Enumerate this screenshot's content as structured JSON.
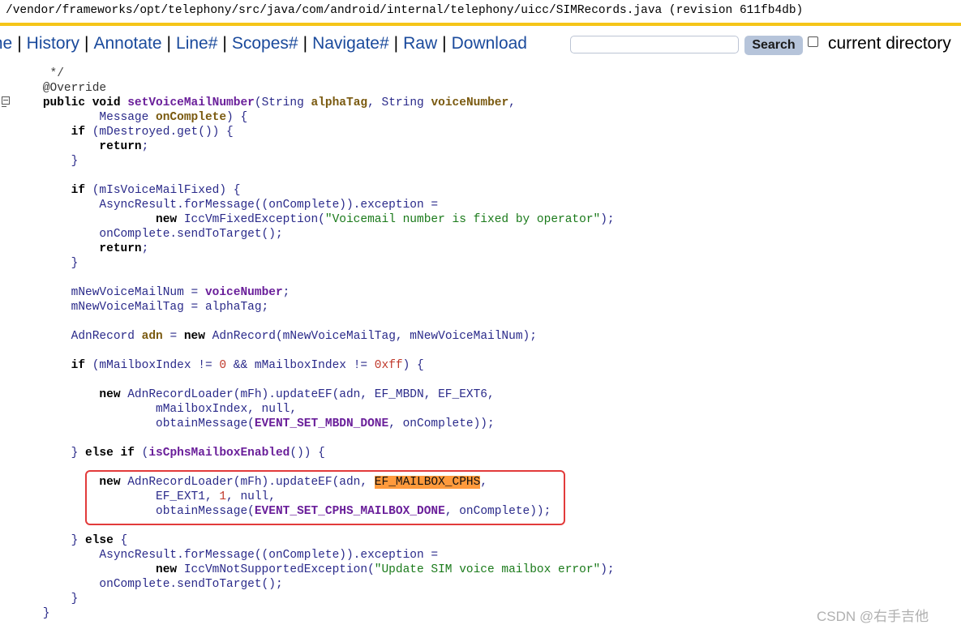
{
  "path_bar": "/vendor/frameworks/opt/telephony/src/java/com/android/internal/telephony/uicc/SIMRecords.java (revision 611fb4db)",
  "nav": {
    "links": [
      "me",
      "History",
      "Annotate",
      "Line#",
      "Scopes#",
      "Navigate#",
      "Raw",
      "Download"
    ],
    "separator": "|"
  },
  "search": {
    "input_value": "",
    "button_label": "Search"
  },
  "current_directory": {
    "label": "current directory",
    "checked": false
  },
  "code_lines": [
    [
      {
        "t": "     */",
        "c": "cm"
      }
    ],
    [
      {
        "t": "    @Override",
        "c": "ann"
      }
    ],
    [
      {
        "t": "    ",
        "c": ""
      },
      {
        "t": "public void ",
        "c": "kw"
      },
      {
        "t": "setVoiceMailNumber",
        "c": "fn"
      },
      {
        "t": "(String ",
        "c": ""
      },
      {
        "t": "alphaTag",
        "c": "lv"
      },
      {
        "t": ", String ",
        "c": ""
      },
      {
        "t": "voiceNumber",
        "c": "lv"
      },
      {
        "t": ",",
        "c": ""
      }
    ],
    [
      {
        "t": "            Message ",
        "c": ""
      },
      {
        "t": "onComplete",
        "c": "lv"
      },
      {
        "t": ") {",
        "c": ""
      }
    ],
    [
      {
        "t": "        ",
        "c": ""
      },
      {
        "t": "if",
        "c": "kw"
      },
      {
        "t": " (mDestroyed.get()) {",
        "c": ""
      }
    ],
    [
      {
        "t": "            ",
        "c": ""
      },
      {
        "t": "return",
        "c": "kw"
      },
      {
        "t": ";",
        "c": ""
      }
    ],
    [
      {
        "t": "        }",
        "c": ""
      }
    ],
    [
      {
        "t": "",
        "c": ""
      }
    ],
    [
      {
        "t": "        ",
        "c": ""
      },
      {
        "t": "if",
        "c": "kw"
      },
      {
        "t": " (mIsVoiceMailFixed) {",
        "c": ""
      }
    ],
    [
      {
        "t": "            AsyncResult.forMessage((onComplete)).exception =",
        "c": ""
      }
    ],
    [
      {
        "t": "                    ",
        "c": ""
      },
      {
        "t": "new",
        "c": "kw"
      },
      {
        "t": " IccVmFixedException(",
        "c": ""
      },
      {
        "t": "\"Voicemail number is fixed by operator\"",
        "c": "str"
      },
      {
        "t": ");",
        "c": ""
      }
    ],
    [
      {
        "t": "            onComplete.sendToTarget();",
        "c": ""
      }
    ],
    [
      {
        "t": "            ",
        "c": ""
      },
      {
        "t": "return",
        "c": "kw"
      },
      {
        "t": ";",
        "c": ""
      }
    ],
    [
      {
        "t": "        }",
        "c": ""
      }
    ],
    [
      {
        "t": "",
        "c": ""
      }
    ],
    [
      {
        "t": "        mNewVoiceMailNum = ",
        "c": ""
      },
      {
        "t": "voiceNumber",
        "c": "fn"
      },
      {
        "t": ";",
        "c": ""
      }
    ],
    [
      {
        "t": "        mNewVoiceMailTag = alphaTag;",
        "c": ""
      }
    ],
    [
      {
        "t": "",
        "c": ""
      }
    ],
    [
      {
        "t": "        AdnRecord ",
        "c": ""
      },
      {
        "t": "adn",
        "c": "lv"
      },
      {
        "t": " = ",
        "c": ""
      },
      {
        "t": "new",
        "c": "kw"
      },
      {
        "t": " AdnRecord(mNewVoiceMailTag, mNewVoiceMailNum);",
        "c": ""
      }
    ],
    [
      {
        "t": "",
        "c": ""
      }
    ],
    [
      {
        "t": "        ",
        "c": ""
      },
      {
        "t": "if",
        "c": "kw"
      },
      {
        "t": " (mMailboxIndex != ",
        "c": ""
      },
      {
        "t": "0",
        "c": "num"
      },
      {
        "t": " && mMailboxIndex != ",
        "c": ""
      },
      {
        "t": "0xff",
        "c": "num"
      },
      {
        "t": ") {",
        "c": ""
      }
    ],
    [
      {
        "t": "",
        "c": ""
      }
    ],
    [
      {
        "t": "            ",
        "c": ""
      },
      {
        "t": "new",
        "c": "kw"
      },
      {
        "t": " AdnRecordLoader(mFh).updateEF(adn, EF_MBDN, EF_EXT6,",
        "c": ""
      }
    ],
    [
      {
        "t": "                    mMailboxIndex, null,",
        "c": ""
      }
    ],
    [
      {
        "t": "                    obtainMessage(",
        "c": ""
      },
      {
        "t": "EVENT_SET_MBDN_DONE",
        "c": "fn"
      },
      {
        "t": ", onComplete));",
        "c": ""
      }
    ],
    [
      {
        "t": "",
        "c": ""
      }
    ],
    [
      {
        "t": "        } ",
        "c": ""
      },
      {
        "t": "else if",
        "c": "kw"
      },
      {
        "t": " (",
        "c": ""
      },
      {
        "t": "isCphsMailboxEnabled",
        "c": "fn"
      },
      {
        "t": "()) {",
        "c": ""
      }
    ],
    [
      {
        "t": "",
        "c": ""
      }
    ],
    [
      {
        "t": "            ",
        "c": ""
      },
      {
        "t": "new",
        "c": "kw"
      },
      {
        "t": " AdnRecordLoader(mFh).updateEF(adn, ",
        "c": ""
      },
      {
        "t": "EF_MAILBOX_CPHS",
        "c": "hl"
      },
      {
        "t": ",",
        "c": ""
      }
    ],
    [
      {
        "t": "                    EF_EXT1, ",
        "c": ""
      },
      {
        "t": "1",
        "c": "num"
      },
      {
        "t": ", null,",
        "c": ""
      }
    ],
    [
      {
        "t": "                    obtainMessage(",
        "c": ""
      },
      {
        "t": "EVENT_SET_CPHS_MAILBOX_DONE",
        "c": "fn"
      },
      {
        "t": ", onComplete));",
        "c": ""
      }
    ],
    [
      {
        "t": "",
        "c": ""
      }
    ],
    [
      {
        "t": "        } ",
        "c": ""
      },
      {
        "t": "else",
        "c": "kw"
      },
      {
        "t": " {",
        "c": ""
      }
    ],
    [
      {
        "t": "            AsyncResult.forMessage((onComplete)).exception =",
        "c": ""
      }
    ],
    [
      {
        "t": "                    ",
        "c": ""
      },
      {
        "t": "new",
        "c": "kw"
      },
      {
        "t": " IccVmNotSupportedException(",
        "c": ""
      },
      {
        "t": "\"Update SIM voice mailbox error\"",
        "c": "str"
      },
      {
        "t": ");",
        "c": ""
      }
    ],
    [
      {
        "t": "            onComplete.sendToTarget();",
        "c": ""
      }
    ],
    [
      {
        "t": "        }",
        "c": ""
      }
    ],
    [
      {
        "t": "    }",
        "c": ""
      }
    ]
  ],
  "watermark": "CSDN @右手吉他"
}
